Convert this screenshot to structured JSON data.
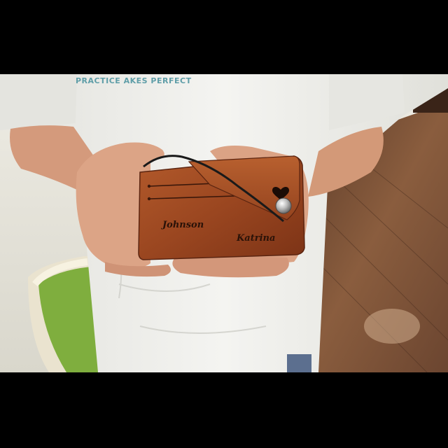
{
  "photo": {
    "shirt_print": "PRACTICE AKES  PERFECT",
    "wallet": {
      "engraving_left": "Johnson",
      "engraving_right": "Katrina",
      "heart_icon": "heart-icon",
      "snap_icon": "snap-button-icon"
    },
    "colors": {
      "letterbox": "#000000",
      "wall": "#e8e6de",
      "floor": "#7a4f33",
      "shirt": "#efefec",
      "skin": "#d9a184",
      "leather": "#9b4a22",
      "stool_green": "#7fae3e"
    }
  }
}
